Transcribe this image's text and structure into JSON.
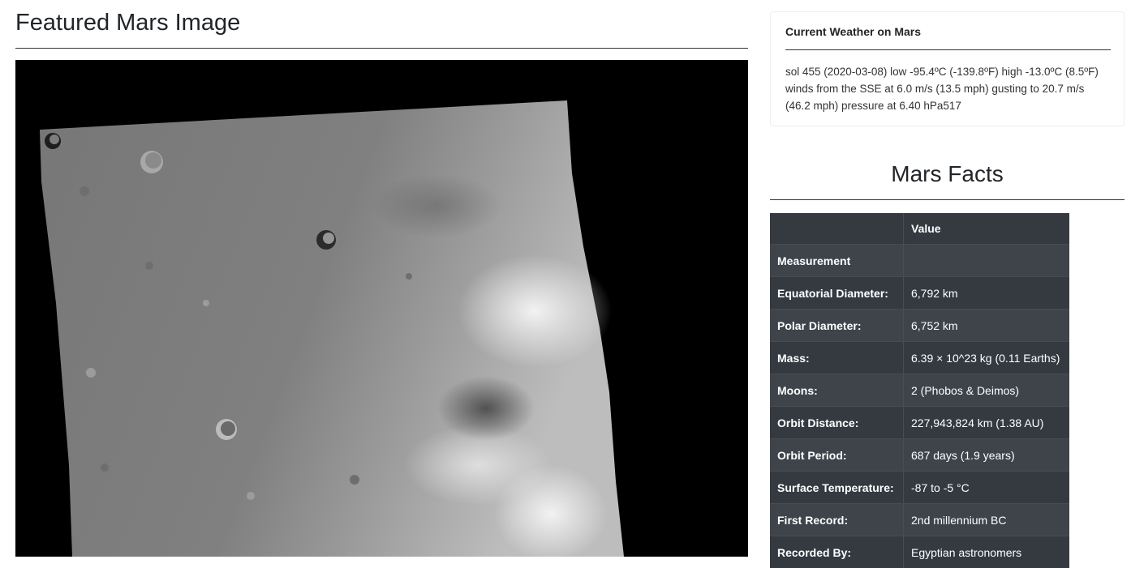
{
  "featured": {
    "title": "Featured Mars Image"
  },
  "weather": {
    "title": "Current Weather on Mars",
    "text": "sol 455 (2020-03-08) low -95.4ºC (-139.8ºF) high -13.0ºC (8.5ºF) winds from the SSE at 6.0 m/s (13.5 mph) gusting to 20.7 m/s (46.2 mph) pressure at 6.40 hPa517"
  },
  "facts": {
    "title": "Mars Facts",
    "header": [
      "",
      "Value"
    ],
    "index_label": "Measurement",
    "rows": [
      {
        "label": "Equatorial Diameter:",
        "value": "6,792 km"
      },
      {
        "label": "Polar Diameter:",
        "value": "6,752 km"
      },
      {
        "label": "Mass:",
        "value": "6.39 × 10^23 kg (0.11 Earths)"
      },
      {
        "label": "Moons:",
        "value": "2 (Phobos & Deimos)"
      },
      {
        "label": "Orbit Distance:",
        "value": "227,943,824 km (1.38 AU)"
      },
      {
        "label": "Orbit Period:",
        "value": "687 days (1.9 years)"
      },
      {
        "label": "Surface Temperature:",
        "value": "-87 to -5 °C"
      },
      {
        "label": "First Record:",
        "value": "2nd millennium BC"
      },
      {
        "label": "Recorded By:",
        "value": "Egyptian astronomers"
      }
    ]
  },
  "colors": {
    "table_dark": "#343a40",
    "table_stripe": "#3e444a",
    "image_background": "#000000"
  }
}
